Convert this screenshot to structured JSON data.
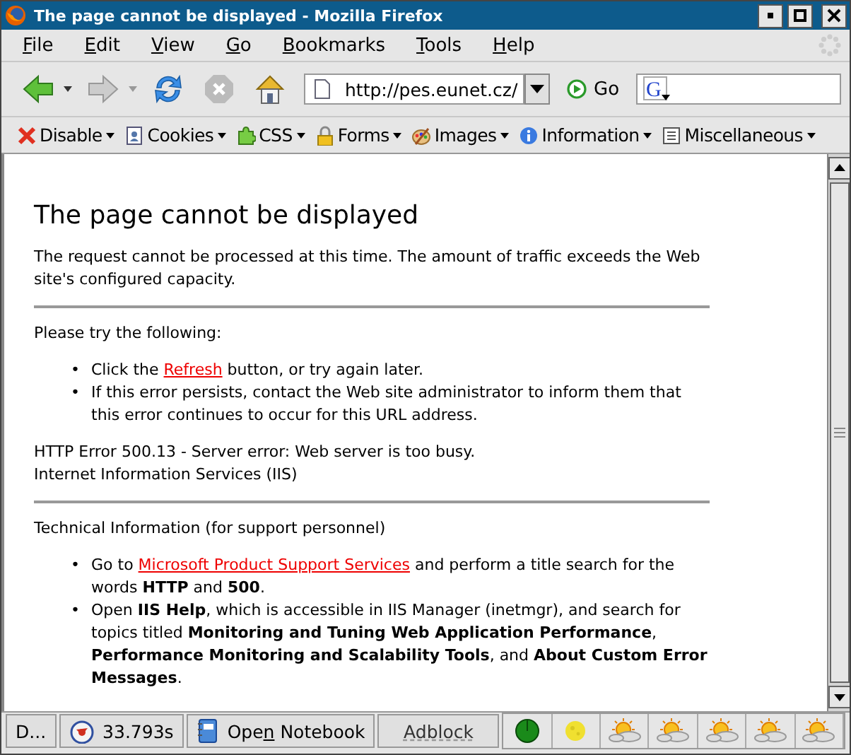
{
  "window": {
    "title": "The page cannot be displayed - Mozilla Firefox"
  },
  "menu": [
    {
      "key": "F",
      "rest": "ile"
    },
    {
      "key": "E",
      "rest": "dit"
    },
    {
      "key": "V",
      "rest": "iew"
    },
    {
      "key": "G",
      "rest": "o"
    },
    {
      "key": "B",
      "rest": "ookmarks"
    },
    {
      "key": "T",
      "rest": "ools"
    },
    {
      "key": "H",
      "rest": "elp"
    }
  ],
  "navigation": {
    "url": "http://pes.eunet.cz/",
    "go": "Go",
    "search_logo": "G"
  },
  "webdev_toolbar": [
    {
      "kind": "disable",
      "label": "Disable"
    },
    {
      "kind": "cookies",
      "label": "Cookies"
    },
    {
      "kind": "css",
      "label": "CSS"
    },
    {
      "kind": "forms",
      "label": "Forms"
    },
    {
      "kind": "images",
      "label": "Images"
    },
    {
      "kind": "information",
      "label": "Information"
    },
    {
      "kind": "misc",
      "label": "Miscellaneous"
    }
  ],
  "page": {
    "heading": "The page cannot be displayed",
    "intro": "The request cannot be processed at this time. The amount of traffic exceeds the Web site's configured capacity.",
    "try_heading": "Please try the following:",
    "try_items": [
      {
        "marker": "•",
        "before": "Click the ",
        "link": "Refresh",
        "after": " button, or try again later."
      },
      {
        "marker": "•",
        "before": "If this error persists, contact the Web site administrator to inform them that this error continues to occur for this URL address."
      }
    ],
    "error_lines": [
      "HTTP Error 500.13 - Server error: Web server is too busy.",
      "Internet Information Services (IIS)"
    ],
    "tech_heading": "Technical Information (for support personnel)",
    "tech_items": [
      {
        "marker": "•",
        "before": "Go to ",
        "link": "Microsoft Product Support Services",
        "after": " and perform a title search for the words **HTTP** and **500**."
      },
      {
        "marker": "•",
        "before": "Open **IIS Help**, which is accessible in IIS Manager (inetmgr), and search for topics titled **Monitoring and Tuning Web Application Performance**, **Performance Monitoring and Scalability Tools**, and **About Custom Error Messages**."
      }
    ]
  },
  "status_bar": {
    "status": "D...",
    "timer": "33.793s",
    "notebook": {
      "pre": "Ope",
      "key": "n",
      "post": " Notebook"
    },
    "adblock": "Adblock",
    "indicators": [
      {
        "kind": "globe"
      },
      {
        "kind": "moon"
      },
      {
        "kind": "weather"
      },
      {
        "kind": "weather"
      },
      {
        "kind": "weather"
      },
      {
        "kind": "weather"
      },
      {
        "kind": "weather"
      }
    ]
  }
}
